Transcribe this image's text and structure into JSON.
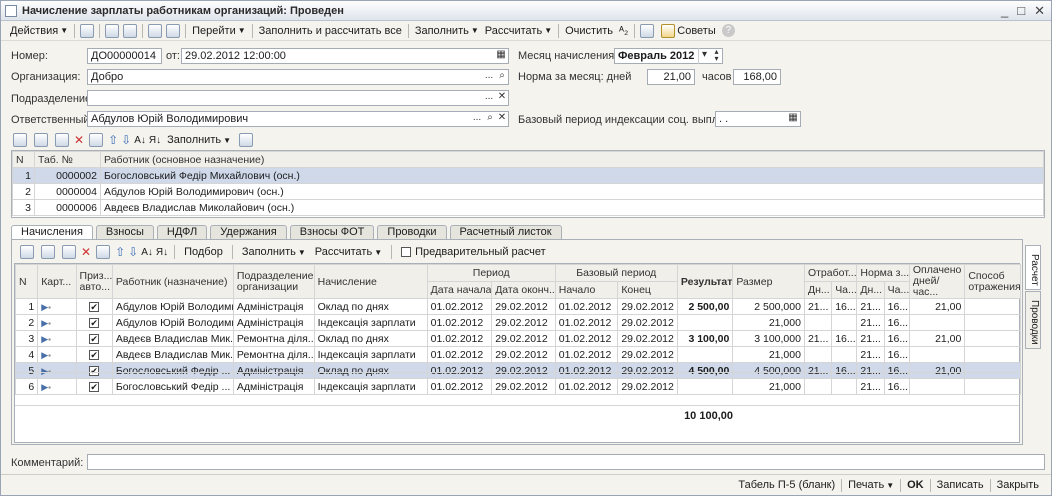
{
  "window": {
    "title": "Начисление зарплаты работникам организаций: Проведен",
    "controls": [
      "_",
      "□",
      "✕"
    ]
  },
  "toolbar": {
    "actions": "Действия",
    "goto": "Перейти",
    "fill_calc_all": "Заполнить и рассчитать все",
    "fill": "Заполнить",
    "calc": "Рассчитать",
    "clear": "Очистить",
    "tips": "Советы"
  },
  "form": {
    "number_label": "Номер:",
    "number": "ДО00000014",
    "date_label": "от:",
    "date": "29.02.2012 12:00:00",
    "org_label": "Организация:",
    "org": "Добро",
    "dept_label": "Подразделение:",
    "dept": "",
    "resp_label": "Ответственный:",
    "resp": "Абдулов Юрій Володимирович",
    "month_label": "Месяц начисления:",
    "month": "Февраль 2012",
    "norm_label": "Норма за месяц: дней",
    "norm_days": "21,00",
    "hours_label": "часов",
    "norm_hours": "168,00",
    "index_label": "Базовый период индексации соц. выплат:",
    "index_value": ". ."
  },
  "workers": {
    "toolbar_fill": "Заполнить",
    "headers": [
      "N",
      "Таб. №",
      "Работник (основное назначение)"
    ],
    "rows": [
      {
        "n": "1",
        "tab": "0000002",
        "name": "Богословський Федір Михайлович (осн.)"
      },
      {
        "n": "2",
        "tab": "0000004",
        "name": "Абдулов Юрій Володимирович (осн.)"
      },
      {
        "n": "3",
        "tab": "0000006",
        "name": "Авдеєв Владислав Миколайович (осн.)"
      }
    ]
  },
  "tabs": [
    "Начисления",
    "Взносы",
    "НДФЛ",
    "Удержания",
    "Взносы ФОТ",
    "Проводки",
    "Расчетный листок"
  ],
  "side_tabs": [
    "Расчет",
    "Проводки"
  ],
  "accruals": {
    "toolbar": {
      "selection": "Подбор",
      "fill": "Заполнить",
      "calc": "Рассчитать",
      "preliminary": "Предварительный расчет"
    },
    "headers": {
      "n": "N",
      "card": "Карт...",
      "auto": "Приз... авто...",
      "worker": "Работник (назначение)",
      "dept": "Подразделение организации",
      "accrual": "Начисление",
      "period": "Период",
      "period_start": "Дата начала",
      "period_end": "Дата оконч...",
      "base": "Базовый период",
      "base_start": "Начало",
      "base_end": "Конец",
      "result": "Результат",
      "size": "Размер",
      "worked": "Отработ...",
      "worked_d": "Дн...",
      "worked_h": "Ча...",
      "norm": "Норма з...",
      "norm_d": "Дн...",
      "norm_h": "Ча...",
      "paid": "Оплачено дней/час...",
      "method": "Способ отражения"
    },
    "rows": [
      {
        "n": "1",
        "worker": "Абдулов Юрій Володими...",
        "dept": "Адміністрація",
        "accrual": "Оклад по днях",
        "ps": "01.02.2012",
        "pe": "29.02.2012",
        "bs": "01.02.2012",
        "be": "29.02.2012",
        "result": "2 500,00",
        "size": "2 500,000",
        "wd": "21...",
        "wh": "16...",
        "nd": "21...",
        "nh": "16...",
        "paid": "21,00"
      },
      {
        "n": "2",
        "worker": "Абдулов Юрій Володими...",
        "dept": "Адміністрація",
        "accrual": "Індексація зарплати",
        "ps": "01.02.2012",
        "pe": "29.02.2012",
        "bs": "01.02.2012",
        "be": "29.02.2012",
        "result": "",
        "size": "21,000",
        "wd": "",
        "wh": "",
        "nd": "21...",
        "nh": "16...",
        "paid": ""
      },
      {
        "n": "3",
        "worker": "Авдеєв Владислав Мик...",
        "dept": "Ремонтна діля...",
        "accrual": "Оклад по днях",
        "ps": "01.02.2012",
        "pe": "29.02.2012",
        "bs": "01.02.2012",
        "be": "29.02.2012",
        "result": "3 100,00",
        "size": "3 100,000",
        "wd": "21...",
        "wh": "16...",
        "nd": "21...",
        "nh": "16...",
        "paid": "21,00"
      },
      {
        "n": "4",
        "worker": "Авдеєв Владислав Мик...",
        "dept": "Ремонтна діля...",
        "accrual": "Індексація зарплати",
        "ps": "01.02.2012",
        "pe": "29.02.2012",
        "bs": "01.02.2012",
        "be": "29.02.2012",
        "result": "",
        "size": "21,000",
        "wd": "",
        "wh": "",
        "nd": "21...",
        "nh": "16...",
        "paid": ""
      },
      {
        "n": "5",
        "worker": "Богословський Федір ...",
        "dept": "Адміністрація",
        "accrual": "Оклад по днях",
        "ps": "01.02.2012",
        "pe": "29.02.2012",
        "bs": "01.02.2012",
        "be": "29.02.2012",
        "result": "4 500,00",
        "size": "4 500,000",
        "wd": "21...",
        "wh": "16...",
        "nd": "21...",
        "nh": "16...",
        "paid": "21,00"
      },
      {
        "n": "6",
        "worker": "Богословський Федір ...",
        "dept": "Адміністрація",
        "accrual": "Індексація зарплати",
        "ps": "01.02.2012",
        "pe": "29.02.2012",
        "bs": "01.02.2012",
        "be": "29.02.2012",
        "result": "",
        "size": "21,000",
        "wd": "",
        "wh": "",
        "nd": "21...",
        "nh": "16...",
        "paid": ""
      }
    ],
    "total": "10 100,00"
  },
  "comment_label": "Комментарий:",
  "statusbar": {
    "t5": "Табель П-5 (бланк)",
    "print": "Печать",
    "ok": "OK",
    "save": "Записать",
    "close": "Закрыть"
  }
}
